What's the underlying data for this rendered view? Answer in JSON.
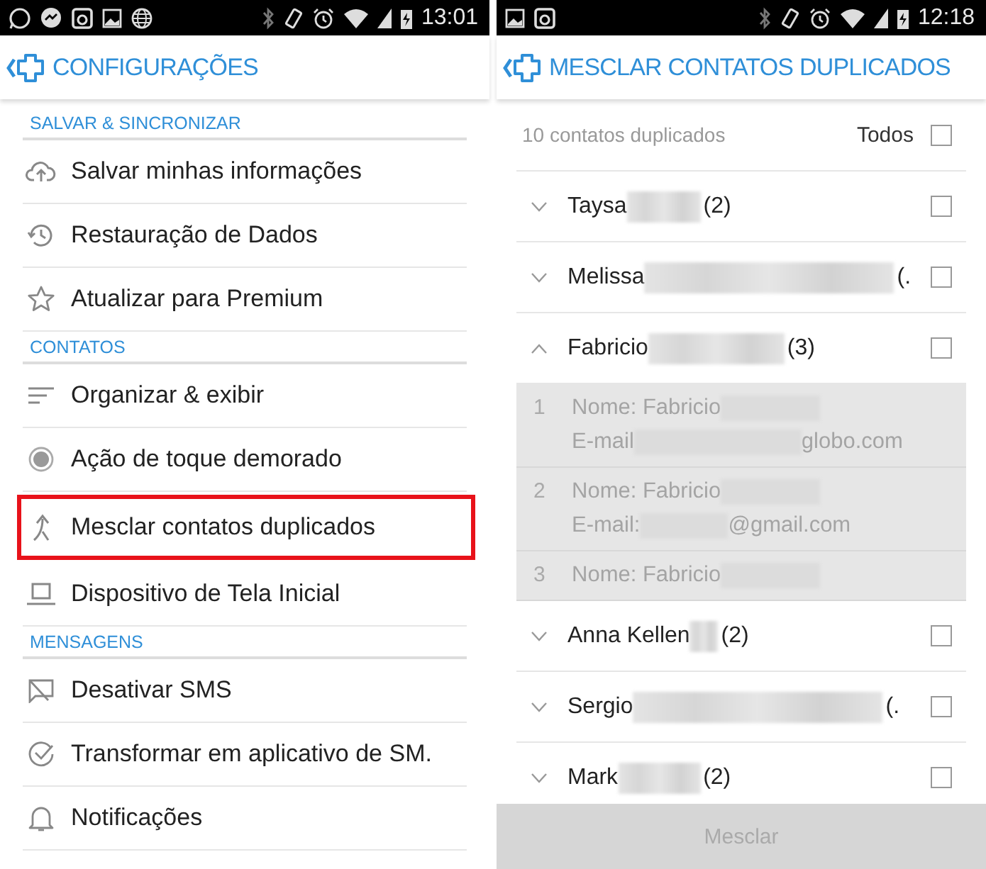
{
  "screens": [
    {
      "status_time": "13:01",
      "title": "CONFIGURAÇÕES",
      "sections": [
        {
          "header": "SALVAR & SINCRONIZAR",
          "items": [
            {
              "label": "Salvar minhas informações",
              "highlighted": false
            },
            {
              "label": "Restauração de Dados",
              "highlighted": false
            },
            {
              "label": "Atualizar para Premium",
              "highlighted": false
            }
          ]
        },
        {
          "header": "CONTATOS",
          "items": [
            {
              "label": "Organizar & exibir",
              "highlighted": false
            },
            {
              "label": "Ação de toque demorado",
              "highlighted": false
            },
            {
              "label": "Mesclar contatos duplicados",
              "highlighted": true
            },
            {
              "label": "Dispositivo de Tela Inicial",
              "highlighted": false
            }
          ]
        },
        {
          "header": "MENSAGENS",
          "items": [
            {
              "label": "Desativar SMS",
              "highlighted": false
            },
            {
              "label": "Transformar em aplicativo de SM.",
              "highlighted": false
            },
            {
              "label": "Notificações",
              "highlighted": false
            }
          ]
        }
      ]
    },
    {
      "status_time": "12:18",
      "title": "MESCLAR CONTATOS DUPLICADOS",
      "summary": "10 contatos duplicados",
      "select_all": {
        "label": "Todos",
        "checked": false
      },
      "contacts": [
        {
          "name": "Taysa",
          "count": "(2)",
          "expanded": false,
          "checked": false
        },
        {
          "name": "Melissa",
          "count": "(.",
          "expanded": false,
          "checked": false
        },
        {
          "name": "Fabricio",
          "count": "(3)",
          "expanded": true,
          "checked": false,
          "entries": [
            {
              "number": "1",
              "lines": [
                {
                  "before": "Nome: Fabricio"
                },
                {
                  "before": "E-mail",
                  "after": "globo.com"
                }
              ]
            },
            {
              "number": "2",
              "lines": [
                {
                  "before": "Nome: Fabricio"
                },
                {
                  "before": "E-mail:",
                  "after": "@gmail.com"
                }
              ]
            },
            {
              "number": "3",
              "lines": [
                {
                  "before": "Nome: Fabricio"
                }
              ]
            }
          ]
        },
        {
          "name": "Anna Kellen",
          "count": "(2)",
          "expanded": false,
          "checked": false
        },
        {
          "name": "Sergio",
          "count": "(.",
          "expanded": false,
          "checked": false
        },
        {
          "name": "Mark",
          "count": "(2)",
          "expanded": false,
          "checked": false
        }
      ],
      "merge_button": {
        "label": "Mesclar",
        "disabled": true
      }
    }
  ]
}
